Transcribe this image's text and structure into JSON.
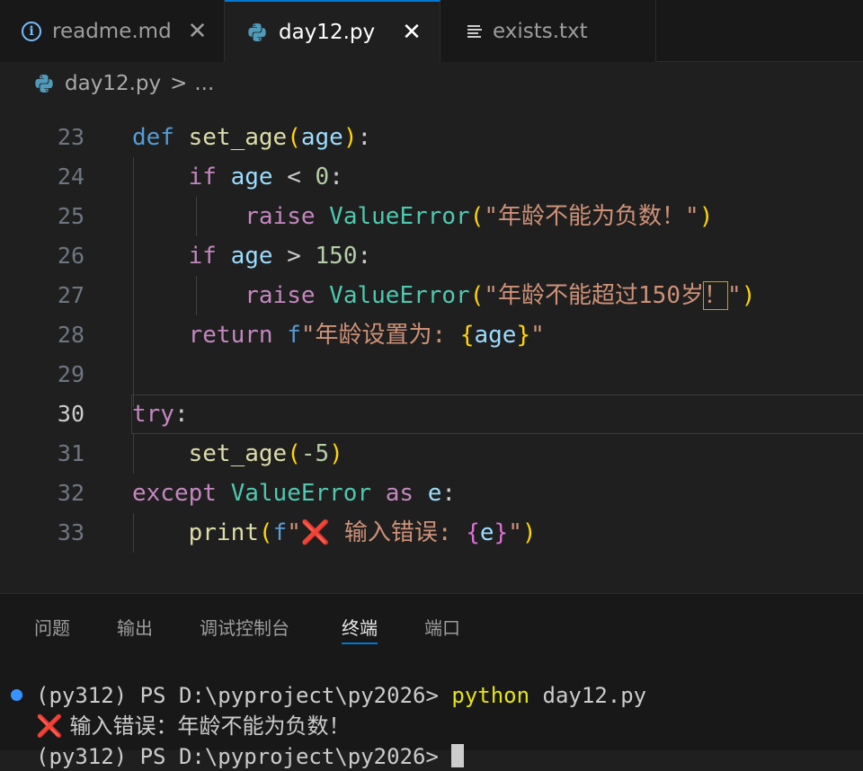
{
  "tabs": [
    {
      "label": "readme.md",
      "icon": "info-icon",
      "active": false
    },
    {
      "label": "day12.py",
      "icon": "python-icon",
      "active": true
    },
    {
      "label": "exists.txt",
      "icon": "text-file-icon",
      "active": false
    }
  ],
  "close_glyph": "✕",
  "breadcrumb": {
    "file": "day12.py",
    "separator": ">",
    "ellipsis": "..."
  },
  "editor": {
    "current_line": 30,
    "lines": [
      {
        "n": "23"
      },
      {
        "n": "24"
      },
      {
        "n": "25"
      },
      {
        "n": "26"
      },
      {
        "n": "27"
      },
      {
        "n": "28"
      },
      {
        "n": "29"
      },
      {
        "n": "30"
      },
      {
        "n": "31"
      },
      {
        "n": "32"
      },
      {
        "n": "33"
      }
    ],
    "code": {
      "l23": {
        "kw": "def",
        "fn": "set_age",
        "param": "age"
      },
      "l24": {
        "kw": "if",
        "var": "age",
        "op": "<",
        "num": "0"
      },
      "l25": {
        "kw": "raise",
        "cls": "ValueError",
        "str": "\"年龄不能为负数！\""
      },
      "l26": {
        "kw": "if",
        "var": "age",
        "op": ">",
        "num": "150"
      },
      "l27": {
        "kw": "raise",
        "cls": "ValueError",
        "str_a": "\"年龄不能超过",
        "num": "150",
        "str_b": "岁",
        "str_box": "！",
        "str_c": "\""
      },
      "l28": {
        "kw": "return",
        "prefix": "f",
        "str": "\"年龄设置为: ",
        "var": "age",
        "end": "\""
      },
      "l30": {
        "kw": "try"
      },
      "l31": {
        "fn": "set_age",
        "num": "-5"
      },
      "l32": {
        "kw": "except",
        "cls": "ValueError",
        "kw2": "as",
        "var": "e"
      },
      "l33": {
        "fn": "print",
        "prefix": "f",
        "str": "\"",
        "emoji": "❌",
        "str2": " 输入错误: ",
        "var": "e",
        "end": "\""
      }
    }
  },
  "panel": {
    "tabs": [
      "问题",
      "输出",
      "调试控制台",
      "终端",
      "端口"
    ],
    "active_tab": "终端"
  },
  "terminal": {
    "prompt": "(py312) PS D:\\pyproject\\py2026> ",
    "command": "python",
    "arg": " day12.py",
    "output_emoji": "❌",
    "output_text": " 输入错误：年龄不能为负数！",
    "prompt2": "(py312) PS D:\\pyproject\\py2026> "
  },
  "colors": {
    "accent": "#0078d4",
    "editor_bg": "#1f1f1f",
    "tabbar_bg": "#181818",
    "keyword": "#c586c0",
    "def_keyword": "#569cd6",
    "function": "#dcdcaa",
    "variable": "#9cdcfe",
    "class": "#4ec9b0",
    "string": "#ce9178",
    "number": "#b5cea8"
  }
}
